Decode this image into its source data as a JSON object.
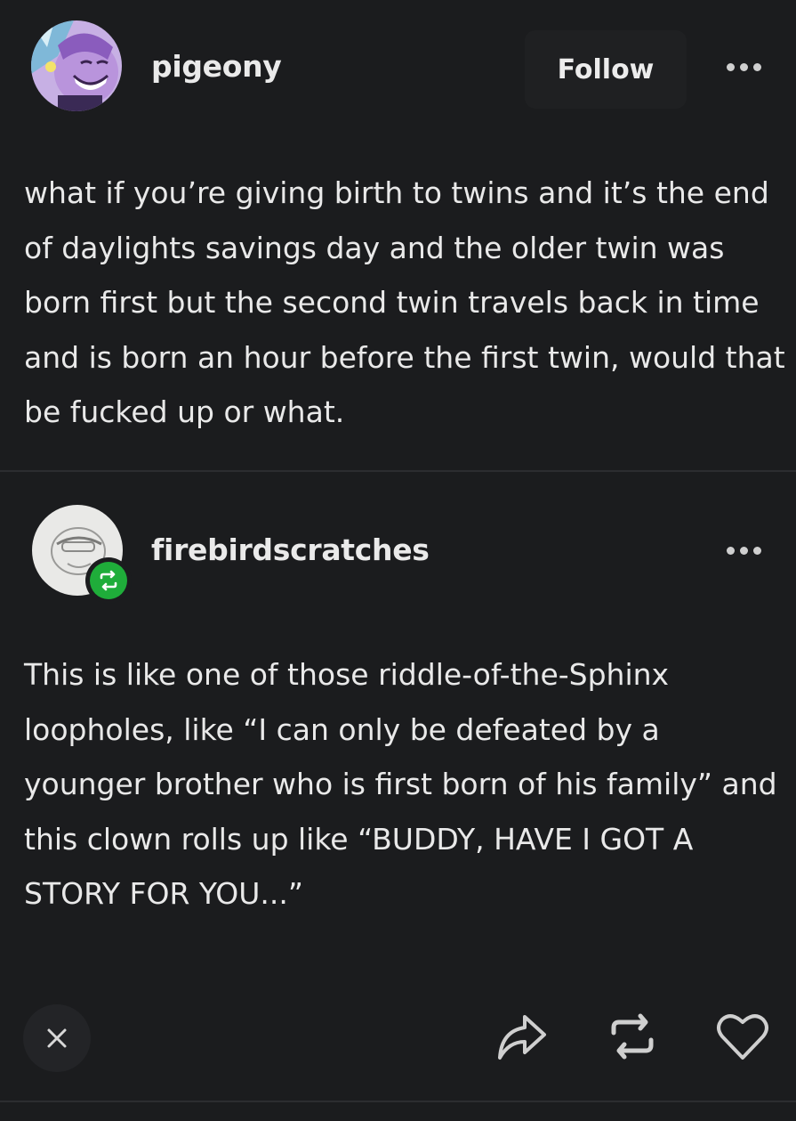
{
  "original_post": {
    "username": "pigeony",
    "follow_label": "Follow",
    "text": "what if you’re giving birth to twins and it’s the end of daylights savings day and the older twin was born first but the second twin travels back in time and is born an hour before the first twin, would that be fucked up or what."
  },
  "reblog": {
    "username": "firebirdscratches",
    "text": "This is like one of those riddle-of-the-Sphinx loopholes, like “I can only be defeated by a younger brother who is first born of his family” and this clown rolls up like “BUDDY, HAVE I GOT A STORY FOR YOU...”"
  },
  "actions": {
    "close_icon": "close-icon",
    "share_icon": "share-icon",
    "reblog_icon": "reblog-icon",
    "like_icon": "heart-icon"
  },
  "colors": {
    "background": "#1b1c1e",
    "reblog_badge": "#1fad3a"
  }
}
